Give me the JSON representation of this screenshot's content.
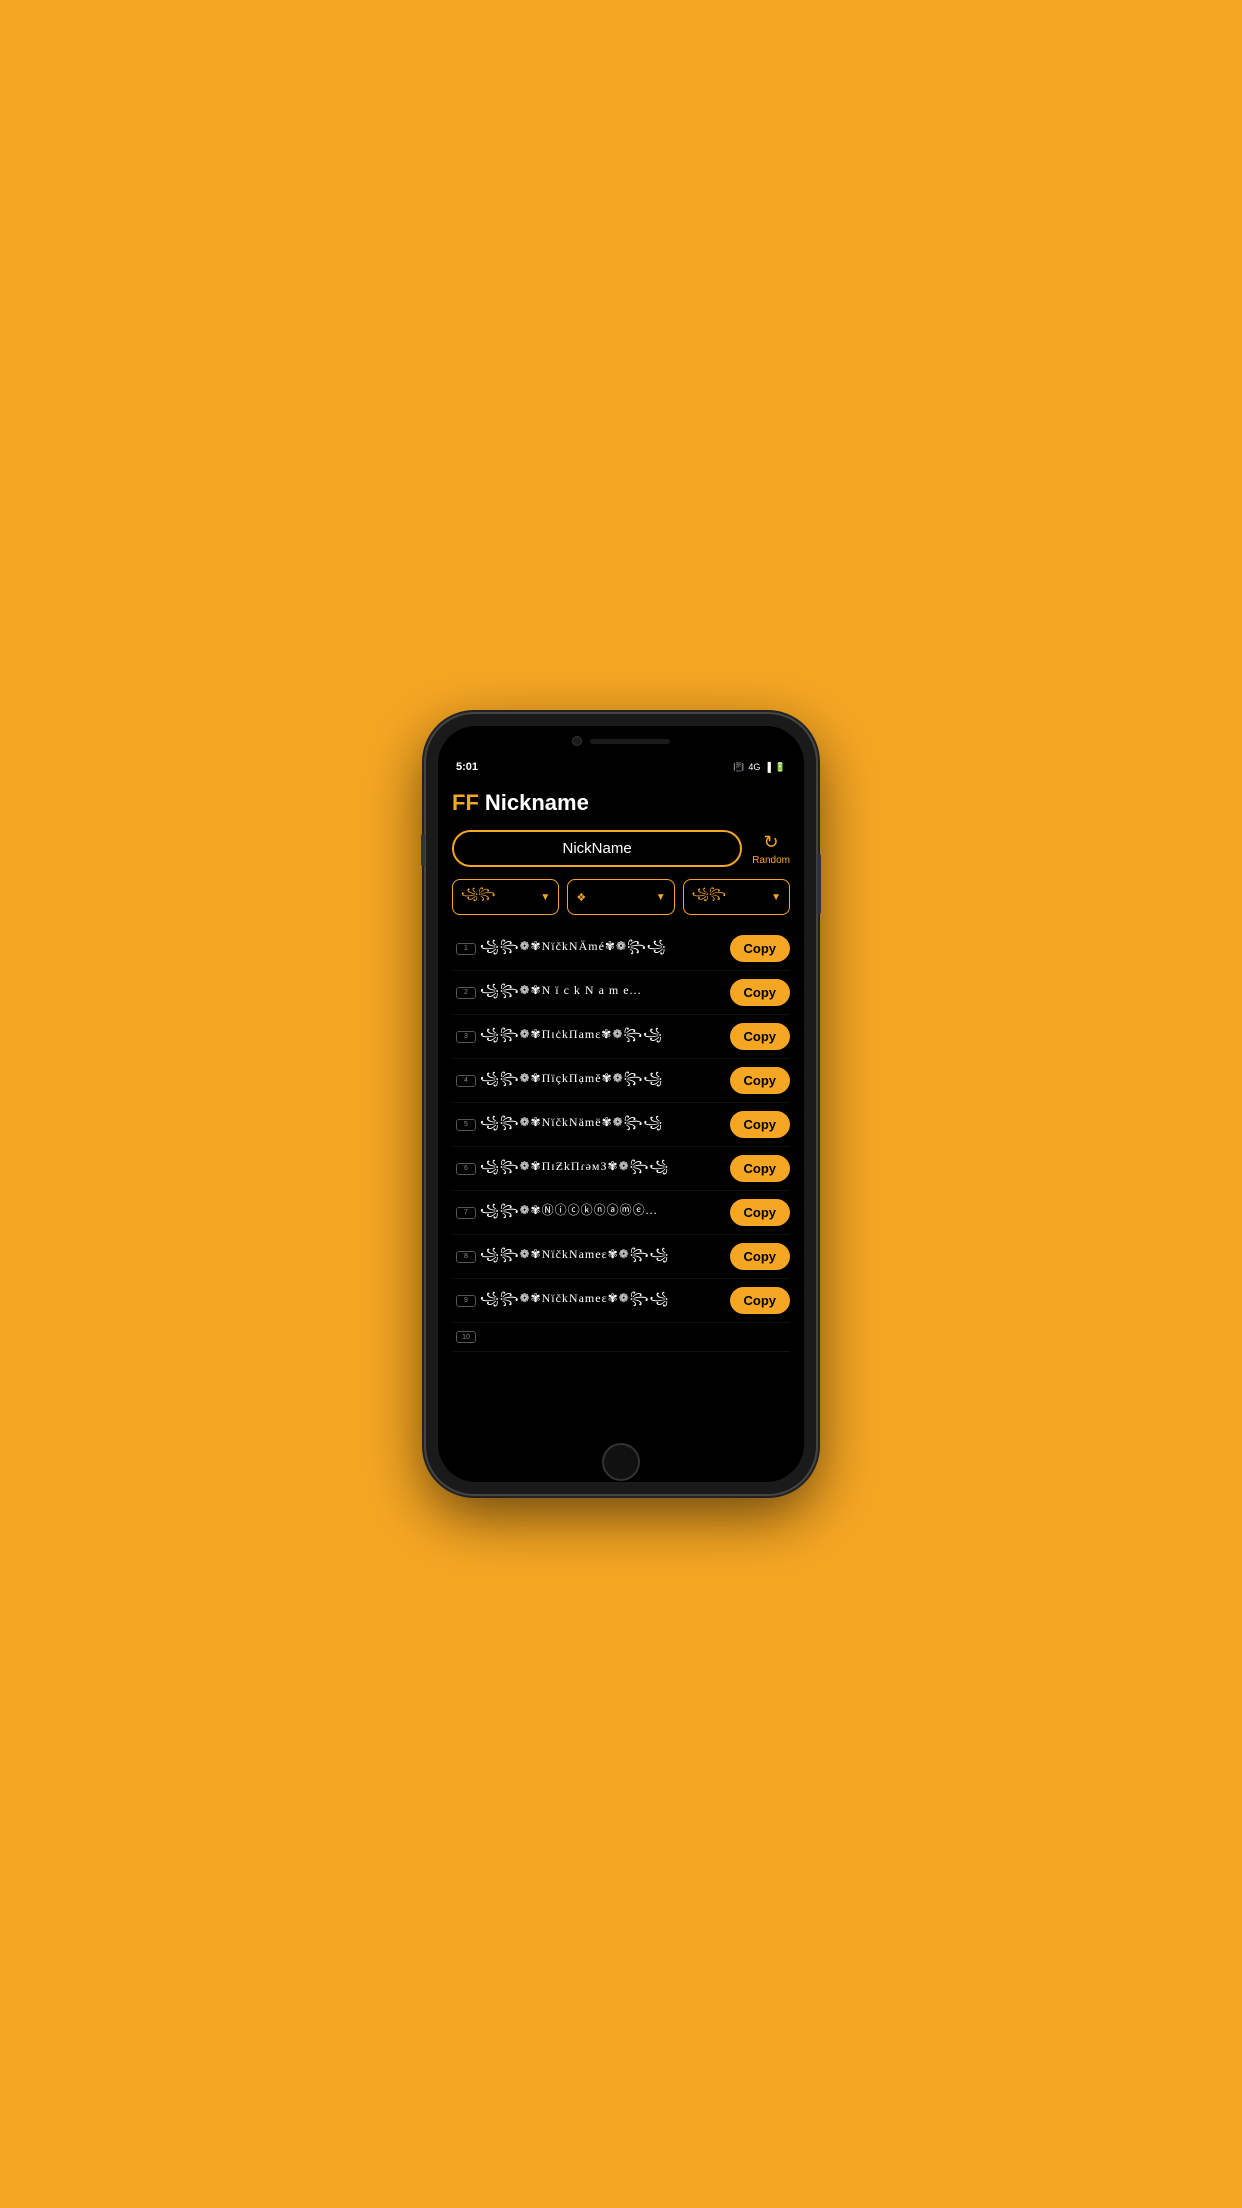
{
  "device": {
    "time": "5:01",
    "status_icons": [
      "vibrate",
      "4G",
      "signal",
      "battery"
    ]
  },
  "header": {
    "ff_label": "FF",
    "nickname_label": "Nickname"
  },
  "input": {
    "value": "NickName",
    "placeholder": "NickName"
  },
  "random_btn": {
    "icon": "↻",
    "label": "Random"
  },
  "dropdowns": [
    {
      "text": "꧁꧂",
      "arrow": "▼"
    },
    {
      "text": "❖",
      "arrow": "▼"
    },
    {
      "text": "꧁꧂",
      "arrow": "▼"
    }
  ],
  "copy_label": "Copy",
  "nickname_items": [
    {
      "number": "1",
      "text": "꧁꧂❁✾NïčkNÄmé✾❁꧂꧁"
    },
    {
      "number": "2",
      "text": "꧁꧂❁✾N ï c k N a m e..."
    },
    {
      "number": "3",
      "text": "꧁꧂❁✾ПɪċkПamɛ✾❁꧂꧁"
    },
    {
      "number": "4",
      "text": "꧁꧂❁✾ПïçkПạmě✾❁꧂꧁"
    },
    {
      "number": "5",
      "text": "꧁꧂❁✾NïčkNämë✾❁꧂꧁"
    },
    {
      "number": "6",
      "text": "꧁꧂❁✾ПɪƵkПɾəмЗ✾❁꧂꧁"
    },
    {
      "number": "7",
      "text": "꧁꧂❁✾Ⓝⓘⓒⓚⓝⓐⓜⓔ..."
    },
    {
      "number": "8",
      "text": "꧁꧂❁✾NïčkNameɛ✾❁꧂꧁"
    },
    {
      "number": "9",
      "text": "꧁꧂❁✾NïčkNameɛ✾❁꧂꧁"
    },
    {
      "number": "10",
      "text": ""
    }
  ]
}
